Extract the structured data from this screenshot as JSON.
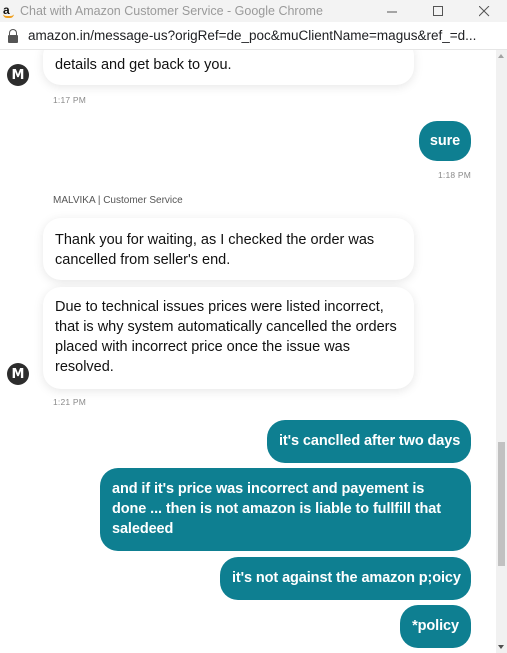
{
  "window": {
    "title": "Chat with Amazon Customer Service - Google Chrome",
    "favicon_letter": "a"
  },
  "address": {
    "url": "amazon.in/message-us?origRef=de_poc&muClientName=magus&ref_=d..."
  },
  "chat": {
    "messages": [
      {
        "from": "agent",
        "text": "details and get back to you."
      },
      {
        "from": "agent_time",
        "text": "1:17 PM"
      },
      {
        "from": "user",
        "text": "sure"
      },
      {
        "from": "user_time",
        "text": "1:18 PM"
      },
      {
        "from": "sender",
        "text": "MALVIKA | Customer Service"
      },
      {
        "from": "agent",
        "text": "Thank you for waiting, as I checked the order was cancelled from seller's end."
      },
      {
        "from": "agent",
        "text": "Due to technical issues prices were listed incorrect, that is why system automatically cancelled the orders placed with incorrect price once the issue was resolved."
      },
      {
        "from": "agent_time",
        "text": "1:21 PM"
      },
      {
        "from": "user",
        "text": "it's canclled after two days"
      },
      {
        "from": "user",
        "text": "and if it's price was incorrect and payement is done ... then is not amazon is liable to fullfill that saledeed"
      },
      {
        "from": "user",
        "text": "it's not against the amazon p;oicy"
      },
      {
        "from": "user",
        "text": "*policy"
      }
    ],
    "avatar_letter": "M"
  },
  "colors": {
    "user_bubble": "#0e7f91",
    "agent_bubble": "#ffffff",
    "avatar": "#2d2d2d"
  }
}
